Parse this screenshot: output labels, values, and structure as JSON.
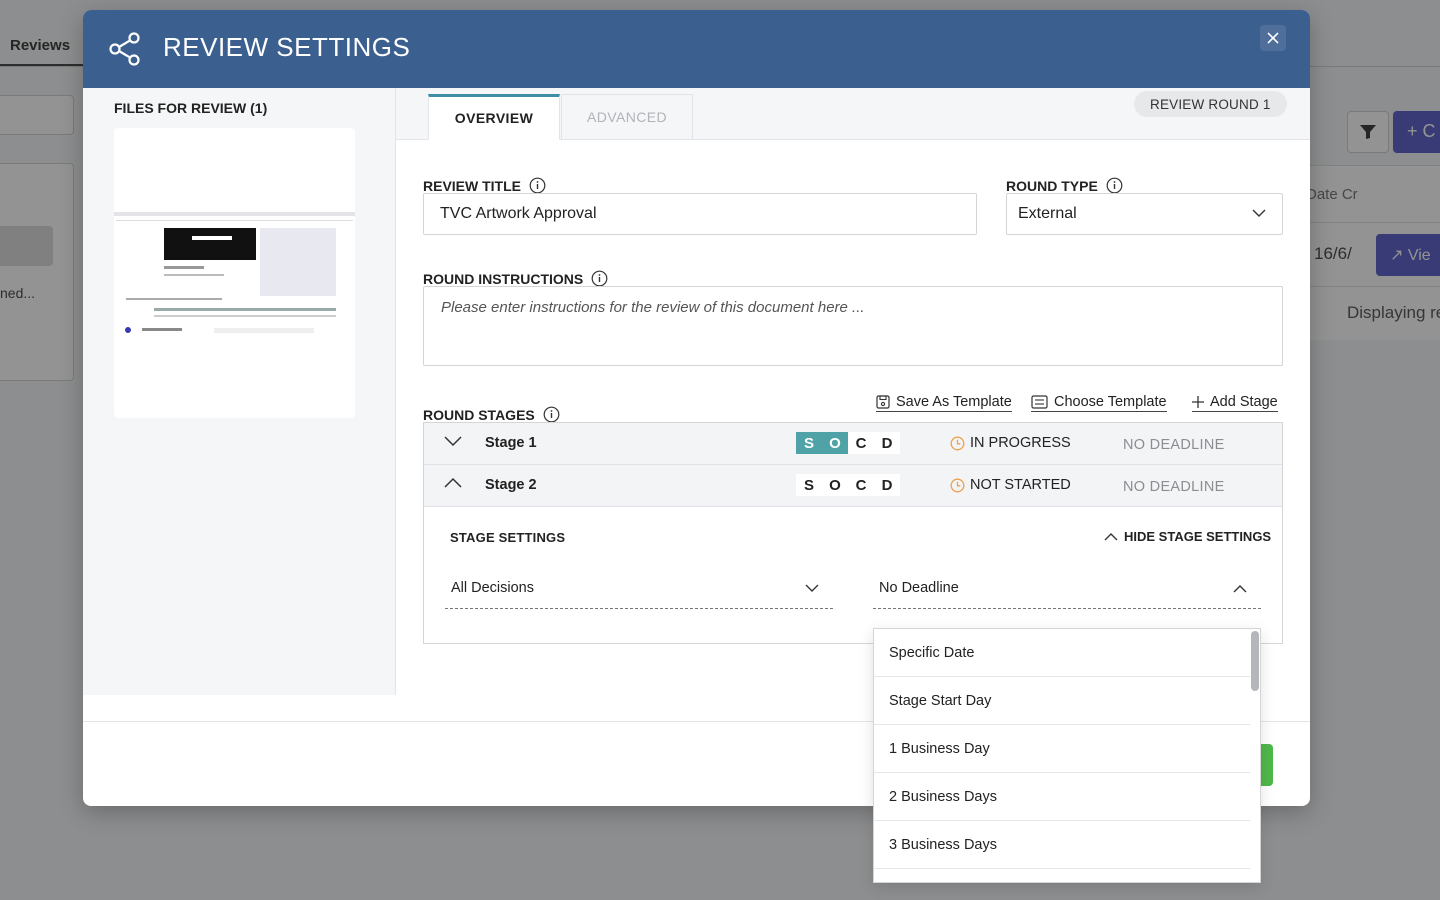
{
  "background": {
    "tab_label": "Reviews",
    "truncated_left_text": "ned...",
    "table_header_partial": "Date Cr",
    "table_cell_partial": "16/6/",
    "displaying_partial": "Displaying re",
    "create_button_partial": "+ C",
    "view_button_partial": "Vie"
  },
  "modal": {
    "title": "REVIEW SETTINGS",
    "files_title": "FILES FOR REVIEW (1)",
    "tabs": [
      {
        "label": "OVERVIEW",
        "active": true
      },
      {
        "label": "ADVANCED",
        "active": false
      }
    ],
    "round_badge": "REVIEW ROUND 1",
    "review_title_label": "REVIEW TITLE",
    "review_title_value": "TVC Artwork Approval",
    "round_type_label": "ROUND TYPE",
    "round_type_value": "External",
    "round_instructions_label": "ROUND INSTRUCTIONS",
    "round_instructions_placeholder": "Please enter instructions for the review of this document here ...",
    "round_stages_label": "ROUND STAGES",
    "stage_actions": {
      "save_template": "Save As Template",
      "choose_template": "Choose Template",
      "add_stage": "Add Stage"
    },
    "stages": [
      {
        "name": "Stage 1",
        "status": "IN PROGRESS",
        "deadline": "NO DEADLINE",
        "expanded": false,
        "socd": [
          "S",
          "O",
          "C",
          "D"
        ],
        "socd_active": [
          true,
          true,
          false,
          false
        ]
      },
      {
        "name": "Stage 2",
        "status": "NOT STARTED",
        "deadline": "NO DEADLINE",
        "expanded": true,
        "socd": [
          "S",
          "O",
          "C",
          "D"
        ],
        "socd_active": [
          false,
          false,
          false,
          false
        ]
      }
    ],
    "stage_settings_title": "STAGE SETTINGS",
    "hide_stage_settings": "HIDE STAGE SETTINGS",
    "decisions_select": "All Decisions",
    "deadline_select": "No Deadline",
    "deadline_options": [
      "Specific Date",
      "Stage Start Day",
      "1 Business Day",
      "2 Business Days",
      "3 Business Days"
    ]
  },
  "colors": {
    "header": "#3b5f8f",
    "accent_teal": "#4fa3a6",
    "status_orange": "#f0a04b",
    "primary_purple": "#4b4fc7",
    "confirm_green": "#4fb84a"
  }
}
